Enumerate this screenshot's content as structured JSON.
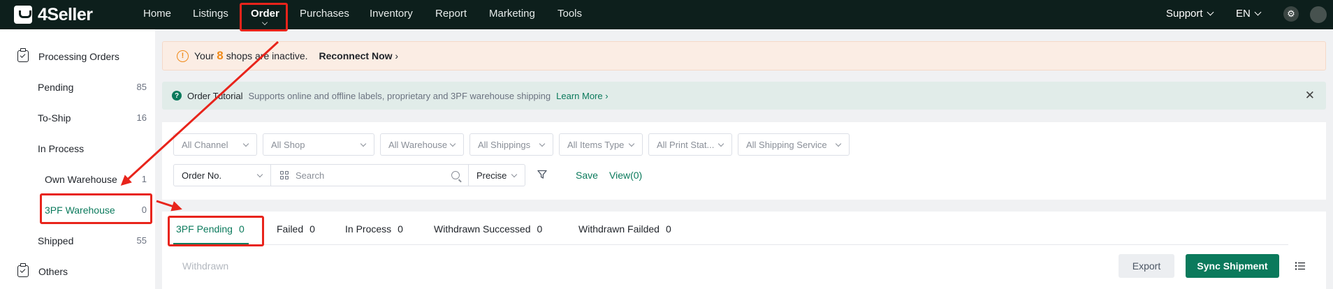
{
  "brand": {
    "name": "4Seller"
  },
  "nav": {
    "items": [
      "Home",
      "Listings",
      "Order",
      "Purchases",
      "Inventory",
      "Report",
      "Marketing",
      "Tools"
    ],
    "active": "Order",
    "support": "Support",
    "language": "EN"
  },
  "sidebar": {
    "group_processing": "Processing Orders",
    "pending": {
      "label": "Pending",
      "count": "85"
    },
    "to_ship": {
      "label": "To-Ship",
      "count": "16"
    },
    "in_process": {
      "label": "In Process"
    },
    "own_warehouse": {
      "label": "Own Warehouse",
      "count": "1"
    },
    "tpf_warehouse": {
      "label": "3PF Warehouse",
      "count": "0"
    },
    "shipped": {
      "label": "Shipped",
      "count": "55"
    },
    "group_others": "Others"
  },
  "warning": {
    "prefix": "Your",
    "count": "8",
    "suffix": "shops are inactive.",
    "action": "Reconnect Now"
  },
  "tutorial": {
    "title": "Order Tutorial",
    "description": "Supports online and offline labels, proprietary and 3PF warehouse shipping",
    "link": "Learn More"
  },
  "filters": {
    "channel": "All Channel",
    "shop": "All Shop",
    "warehouse": "All Warehouse",
    "shippings": "All Shippings",
    "items_type": "All Items Type",
    "print_status": "All Print Stat...",
    "shipping_service": "All Shipping Service",
    "search_field": "Order No.",
    "search_placeholder": "Search",
    "match_mode": "Precise",
    "save": "Save",
    "view": "View(0)"
  },
  "tabs": [
    {
      "label": "3PF Pending",
      "count": "0"
    },
    {
      "label": "Failed",
      "count": "0"
    },
    {
      "label": "In Process",
      "count": "0"
    },
    {
      "label": "Withdrawn Successed",
      "count": "0"
    },
    {
      "label": "Withdrawn Failded",
      "count": "0"
    }
  ],
  "actions": {
    "withdrawn": "Withdrawn",
    "export": "Export",
    "sync": "Sync Shipment"
  },
  "colors": {
    "accent": "#0b7a5c",
    "annotation": "#e8241b",
    "warning": "#f08a18",
    "nav_bg": "#0d1f1c"
  }
}
